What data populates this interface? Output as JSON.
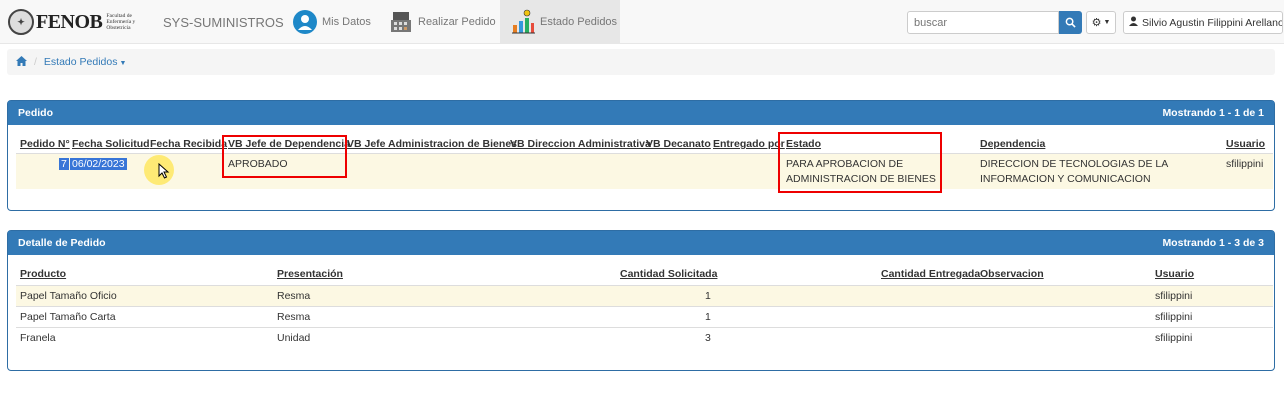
{
  "navbar": {
    "logo_text": "FENOB",
    "logo_subtext": "Facultad de Enfermería y Obstetricia",
    "brand": "SYS-SUMINISTROS",
    "items": [
      {
        "label": "Mis Datos",
        "icon": "user-globe-icon"
      },
      {
        "label": "Realizar Pedido",
        "icon": "cash-register-icon"
      },
      {
        "label": "Estado Pedidos",
        "icon": "bar-chart-icon",
        "active": true
      }
    ],
    "search_placeholder": "buscar",
    "user_name": "Silvio Agustin Filippini Arellano"
  },
  "breadcrumb": {
    "current": "Estado Pedidos"
  },
  "pedido_panel": {
    "title": "Pedido",
    "showing_prefix": "Mostrando",
    "showing_range": "1 - 1",
    "showing_of": "de",
    "showing_total": "1",
    "headers": [
      "Pedido N°",
      "Fecha Solicitud",
      "Fecha Recibida",
      "VB Jefe de Dependencia",
      "VB Jefe Administracion de Bienes",
      "VB Direccion Administrativa",
      "VB Decanato",
      "Entregado por",
      "Estado",
      "Dependencia",
      "Usuario"
    ],
    "row": {
      "pedido_n": "7",
      "fecha_solicitud": "06/02/2023",
      "fecha_recibida": "",
      "vb_jefe_dependencia": "APROBADO",
      "estado_line1": "PARA APROBACION DE",
      "estado_line2": "ADMINISTRACION DE BIENES",
      "dependencia_line1": "DIRECCION DE TECNOLOGIAS DE LA",
      "dependencia_line2": "INFORMACION Y COMUNICACION",
      "usuario": "sfilippini"
    }
  },
  "detalle_panel": {
    "title": "Detalle de Pedido",
    "showing_prefix": "Mostrando",
    "showing_range": "1 - 3",
    "showing_of": "de",
    "showing_total": "3",
    "headers": [
      "Producto",
      "Presentación",
      "Cantidad Solicitada",
      "Cantidad Entregada",
      "Observacion",
      "Usuario"
    ],
    "rows": [
      {
        "producto": "Papel Tamaño Oficio",
        "presentacion": "Resma",
        "cantidad": "1",
        "usuario": "sfilippini"
      },
      {
        "producto": "Papel Tamaño Carta",
        "presentacion": "Resma",
        "cantidad": "1",
        "usuario": "sfilippini"
      },
      {
        "producto": "Franela",
        "presentacion": "Unidad",
        "cantidad": "3",
        "usuario": "sfilippini"
      }
    ]
  },
  "colors": {
    "primary": "#337ab7",
    "highlight_row": "#fcf8e3",
    "annotation_box": "#e00000",
    "selection": "#3875d7"
  }
}
